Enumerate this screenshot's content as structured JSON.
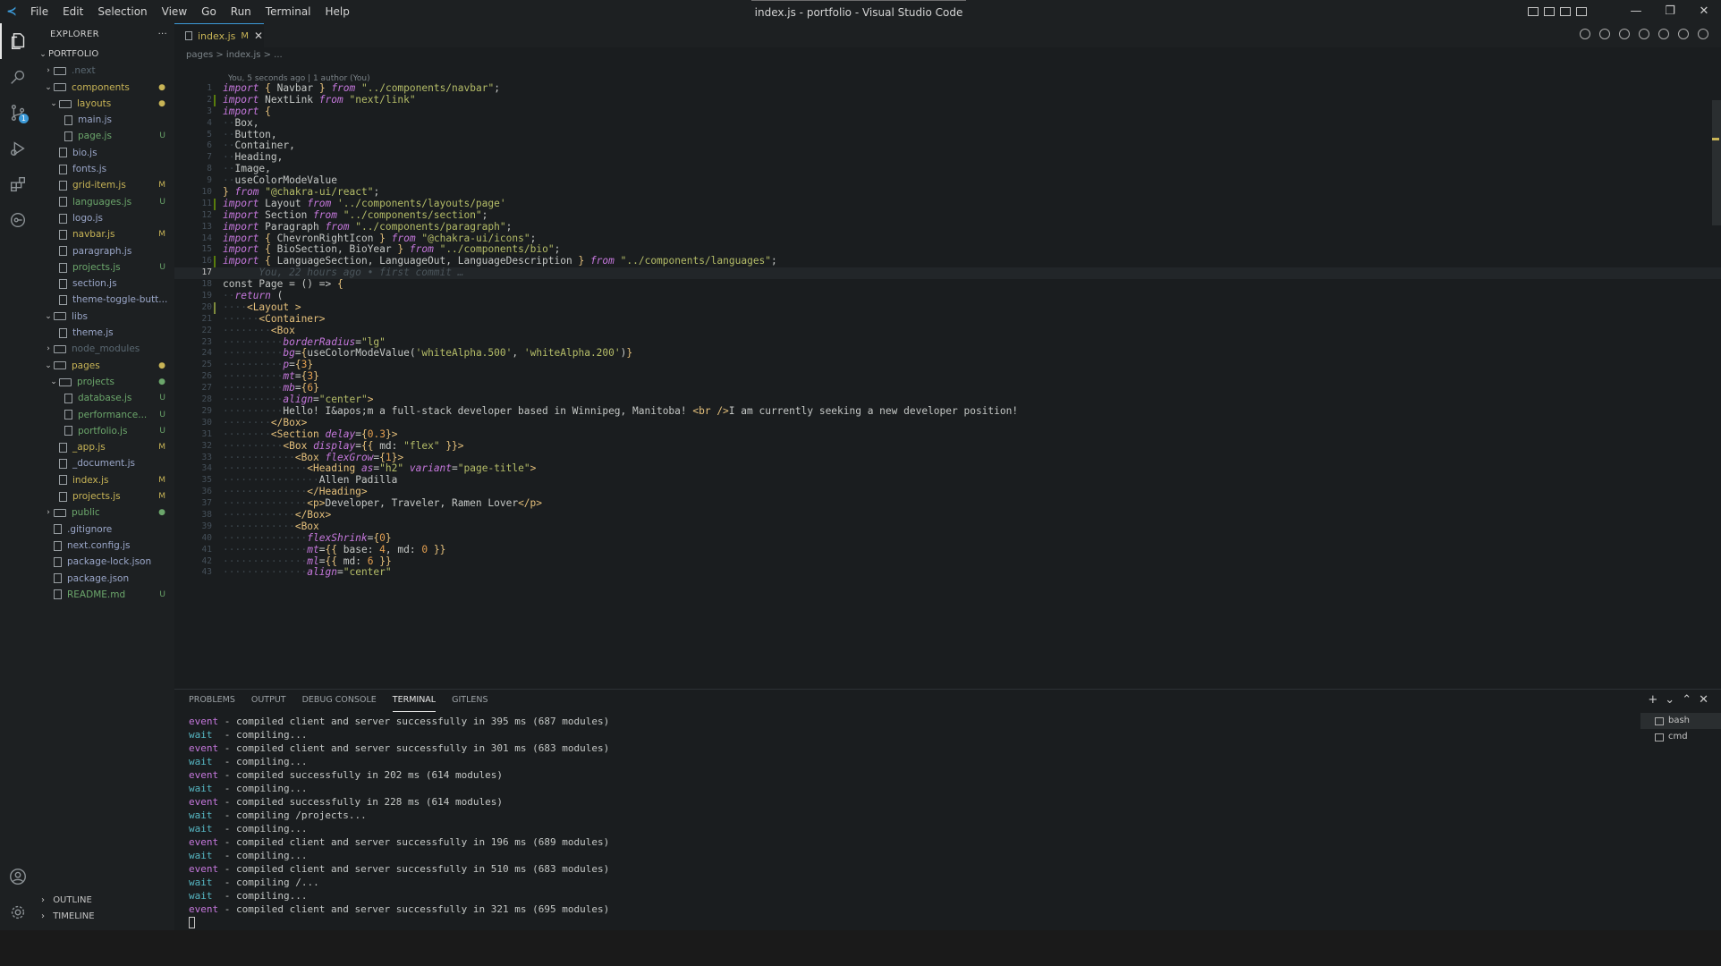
{
  "window": {
    "title": "index.js - portfolio - Visual Studio Code",
    "menu": [
      "File",
      "Edit",
      "Selection",
      "View",
      "Go",
      "Run",
      "Terminal",
      "Help"
    ],
    "controls": [
      "—",
      "❐",
      "✕"
    ]
  },
  "activity_bar": {
    "items": [
      "explorer-icon",
      "search-icon",
      "source-control-icon",
      "run-debug-icon",
      "extensions-icon",
      "gitlens-icon"
    ],
    "scm_badge": "1",
    "bottom": [
      "account-icon",
      "settings-icon"
    ]
  },
  "sidebar": {
    "title": "EXPLORER",
    "more": "···",
    "root": "PORTFOLIO",
    "tree": [
      {
        "indent": 1,
        "kind": "folder",
        "open": false,
        "name": ".next",
        "style": "dim",
        "badge": ""
      },
      {
        "indent": 1,
        "kind": "folder",
        "open": true,
        "name": "components",
        "style": "mod",
        "badge": "●"
      },
      {
        "indent": 2,
        "kind": "folder",
        "open": true,
        "name": "layouts",
        "style": "mod",
        "badge": "●"
      },
      {
        "indent": 3,
        "kind": "file",
        "name": "main.js",
        "style": "normal",
        "badge": ""
      },
      {
        "indent": 3,
        "kind": "file",
        "name": "page.js",
        "style": "untracked",
        "badge": "U"
      },
      {
        "indent": 2,
        "kind": "file",
        "name": "bio.js",
        "style": "normal",
        "badge": ""
      },
      {
        "indent": 2,
        "kind": "file",
        "name": "fonts.js",
        "style": "normal",
        "badge": ""
      },
      {
        "indent": 2,
        "kind": "file",
        "name": "grid-item.js",
        "style": "mod",
        "badge": "M"
      },
      {
        "indent": 2,
        "kind": "file",
        "name": "languages.js",
        "style": "untracked",
        "badge": "U"
      },
      {
        "indent": 2,
        "kind": "file",
        "name": "logo.js",
        "style": "normal",
        "badge": ""
      },
      {
        "indent": 2,
        "kind": "file",
        "name": "navbar.js",
        "style": "mod",
        "badge": "M"
      },
      {
        "indent": 2,
        "kind": "file",
        "name": "paragraph.js",
        "style": "normal",
        "badge": ""
      },
      {
        "indent": 2,
        "kind": "file",
        "name": "projects.js",
        "style": "untracked",
        "badge": "U"
      },
      {
        "indent": 2,
        "kind": "file",
        "name": "section.js",
        "style": "normal",
        "badge": ""
      },
      {
        "indent": 2,
        "kind": "file",
        "name": "theme-toggle-butt...",
        "style": "normal",
        "badge": ""
      },
      {
        "indent": 1,
        "kind": "folder",
        "open": true,
        "name": "libs",
        "style": "normal",
        "badge": ""
      },
      {
        "indent": 2,
        "kind": "file",
        "name": "theme.js",
        "style": "normal",
        "badge": ""
      },
      {
        "indent": 1,
        "kind": "folder",
        "open": false,
        "name": "node_modules",
        "style": "dim",
        "badge": ""
      },
      {
        "indent": 1,
        "kind": "folder",
        "open": true,
        "name": "pages",
        "style": "mod",
        "badge": "●"
      },
      {
        "indent": 2,
        "kind": "folder",
        "open": true,
        "name": "projects",
        "style": "untracked",
        "badge": "●"
      },
      {
        "indent": 3,
        "kind": "file",
        "name": "database.js",
        "style": "untracked",
        "badge": "U"
      },
      {
        "indent": 3,
        "kind": "file",
        "name": "performance...",
        "style": "untracked",
        "badge": "U"
      },
      {
        "indent": 3,
        "kind": "file",
        "name": "portfolio.js",
        "style": "untracked",
        "badge": "U"
      },
      {
        "indent": 2,
        "kind": "file",
        "name": "_app.js",
        "style": "mod",
        "badge": "M"
      },
      {
        "indent": 2,
        "kind": "file",
        "name": "_document.js",
        "style": "normal",
        "badge": ""
      },
      {
        "indent": 2,
        "kind": "file",
        "name": "index.js",
        "style": "mod",
        "badge": "M"
      },
      {
        "indent": 2,
        "kind": "file",
        "name": "projects.js",
        "style": "mod",
        "badge": "M"
      },
      {
        "indent": 1,
        "kind": "folder",
        "open": false,
        "name": "public",
        "style": "untracked",
        "badge": "●"
      },
      {
        "indent": 1,
        "kind": "file",
        "name": ".gitignore",
        "style": "normal",
        "badge": ""
      },
      {
        "indent": 1,
        "kind": "file",
        "name": "next.config.js",
        "style": "normal",
        "badge": ""
      },
      {
        "indent": 1,
        "kind": "file",
        "name": "package-lock.json",
        "style": "normal",
        "badge": ""
      },
      {
        "indent": 1,
        "kind": "file",
        "name": "package.json",
        "style": "normal",
        "badge": ""
      },
      {
        "indent": 1,
        "kind": "file",
        "name": "README.md",
        "style": "untracked",
        "badge": "U"
      }
    ],
    "outline": "OUTLINE",
    "timeline": "TIMELINE"
  },
  "editor": {
    "tab": {
      "name": "index.js",
      "status": "M",
      "close": "✕"
    },
    "breadcrumb": "pages  >  index.js  > ...",
    "blame_header": "You, 5 seconds ago | 1 author (You)",
    "current_line": 17,
    "lines": [
      {
        "n": 1,
        "g": "",
        "h": "<span class='kw'>import</span> <span class='punct'>{</span> Navbar <span class='punct'>}</span> <span class='kw'>from</span> <span class='str'>\"../components/navbar\"</span>;"
      },
      {
        "n": 2,
        "g": "add",
        "h": "<span class='kw'>import</span> NextLink <span class='kw'>from</span> <span class='str'>\"next/link\"</span>"
      },
      {
        "n": 3,
        "g": "",
        "h": "<span class='kw'>import</span> <span class='punct'>{</span>"
      },
      {
        "n": 4,
        "g": "",
        "h": "<span class='ghost'>··</span>Box,"
      },
      {
        "n": 5,
        "g": "",
        "h": "<span class='ghost'>··</span>Button,"
      },
      {
        "n": 6,
        "g": "",
        "h": "<span class='ghost'>··</span>Container,"
      },
      {
        "n": 7,
        "g": "",
        "h": "<span class='ghost'>··</span>Heading,"
      },
      {
        "n": 8,
        "g": "",
        "h": "<span class='ghost'>··</span>Image,"
      },
      {
        "n": 9,
        "g": "",
        "h": "<span class='ghost'>··</span>useColorModeValue"
      },
      {
        "n": 10,
        "g": "",
        "h": "<span class='punct'>}</span> <span class='kw'>from</span> <span class='str'>\"@chakra-ui/react\"</span>;"
      },
      {
        "n": 11,
        "g": "add",
        "h": "<span class='kw'>import</span> Layout <span class='kw'>from</span> <span class='str'>'../components/layouts/page'</span>"
      },
      {
        "n": 12,
        "g": "",
        "h": "<span class='kw'>import</span> Section <span class='kw'>from</span> <span class='str'>\"../components/section\"</span>;"
      },
      {
        "n": 13,
        "g": "",
        "h": "<span class='kw'>import</span> Paragraph <span class='kw'>from</span> <span class='str'>\"../components/paragraph\"</span>;"
      },
      {
        "n": 14,
        "g": "",
        "h": "<span class='kw'>import</span> <span class='punct'>{</span> ChevronRightIcon <span class='punct'>}</span> <span class='kw'>from</span> <span class='str'>\"@chakra-ui/icons\"</span>;"
      },
      {
        "n": 15,
        "g": "",
        "h": "<span class='kw'>import</span> <span class='punct'>{</span> BioSection, BioYear <span class='punct'>}</span> <span class='kw'>from</span> <span class='str'>\"../components/bio\"</span>;"
      },
      {
        "n": 16,
        "g": "add",
        "h": "<span class='kw'>import</span> <span class='punct'>{</span> LanguageSection, LanguageOut, LanguageDescription <span class='punct'>}</span> <span class='kw'>from</span> <span class='str'>\"../components/languages\"</span>;"
      },
      {
        "n": 17,
        "g": "",
        "h": "<span class='blame'>      You, 22 hours ago • first commit …</span>"
      },
      {
        "n": 18,
        "g": "",
        "h": "const Page = () => <span class='punct'>{</span>"
      },
      {
        "n": 19,
        "g": "",
        "h": "<span class='ghost'>··</span><span class='kw'>return</span> ("
      },
      {
        "n": 20,
        "g": "chg",
        "h": "<span class='ghost'>····</span><span class='tag'>&lt;Layout</span> <span class='tag'>&gt;</span>"
      },
      {
        "n": 21,
        "g": "",
        "h": "<span class='ghost'>······</span><span class='tag'>&lt;Container&gt;</span>"
      },
      {
        "n": 22,
        "g": "",
        "h": "<span class='ghost'>········</span><span class='tag'>&lt;Box</span>"
      },
      {
        "n": 23,
        "g": "",
        "h": "<span class='ghost'>··········</span><span class='attr'>borderRadius</span>=<span class='str'>\"lg\"</span>"
      },
      {
        "n": 24,
        "g": "",
        "h": "<span class='ghost'>··········</span><span class='attr'>bg</span>=<span class='punct'>{</span>useColorModeValue(<span class='str'>'whiteAlpha.500'</span>, <span class='str'>'whiteAlpha.200'</span>)<span class='punct'>}</span>"
      },
      {
        "n": 25,
        "g": "",
        "h": "<span class='ghost'>··········</span><span class='attr'>p</span>=<span class='punct'>{</span><span class='num'>3</span><span class='punct'>}</span>"
      },
      {
        "n": 26,
        "g": "",
        "h": "<span class='ghost'>··········</span><span class='attr'>mt</span>=<span class='punct'>{</span><span class='num'>3</span><span class='punct'>}</span>"
      },
      {
        "n": 27,
        "g": "",
        "h": "<span class='ghost'>··········</span><span class='attr'>mb</span>=<span class='punct'>{</span><span class='num'>6</span><span class='punct'>}</span>"
      },
      {
        "n": 28,
        "g": "",
        "h": "<span class='ghost'>··········</span><span class='attr'>align</span>=<span class='str'>\"center\"</span><span class='tag'>&gt;</span>"
      },
      {
        "n": 29,
        "g": "",
        "h": "<span class='ghost'>··········</span>Hello! I&amp;apos;m a full-stack developer based in Winnipeg, Manitoba! <span class='tag'>&lt;br /&gt;</span>I am currently seeking a new developer position!"
      },
      {
        "n": 30,
        "g": "",
        "h": "<span class='ghost'>········</span><span class='tag'>&lt;/Box&gt;</span>"
      },
      {
        "n": 31,
        "g": "",
        "h": "<span class='ghost'>········</span><span class='tag'>&lt;Section</span> <span class='attr'>delay</span>=<span class='punct'>{</span><span class='num'>0.3</span><span class='punct'>}</span><span class='tag'>&gt;</span>"
      },
      {
        "n": 32,
        "g": "",
        "h": "<span class='ghost'>··········</span><span class='tag'>&lt;Box</span> <span class='attr'>display</span>=<span class='punct'>{{</span> md: <span class='str'>\"flex\"</span> <span class='punct'>}}</span><span class='tag'>&gt;</span>"
      },
      {
        "n": 33,
        "g": "",
        "h": "<span class='ghost'>············</span><span class='tag'>&lt;Box</span> <span class='attr'>flexGrow</span>=<span class='punct'>{</span><span class='num'>1</span><span class='punct'>}</span><span class='tag'>&gt;</span>"
      },
      {
        "n": 34,
        "g": "",
        "h": "<span class='ghost'>··············</span><span class='tag'>&lt;Heading</span> <span class='attr'>as</span>=<span class='str'>\"h2\"</span> <span class='attr'>variant</span>=<span class='str'>\"page-title\"</span><span class='tag'>&gt;</span>"
      },
      {
        "n": 35,
        "g": "",
        "h": "<span class='ghost'>················</span>Allen Padilla"
      },
      {
        "n": 36,
        "g": "",
        "h": "<span class='ghost'>··············</span><span class='tag'>&lt;/Heading&gt;</span>"
      },
      {
        "n": 37,
        "g": "",
        "h": "<span class='ghost'>··············</span><span class='tag'>&lt;p&gt;</span>Developer, Traveler, Ramen Lover<span class='tag'>&lt;/p&gt;</span>"
      },
      {
        "n": 38,
        "g": "",
        "h": "<span class='ghost'>············</span><span class='tag'>&lt;/Box&gt;</span>"
      },
      {
        "n": 39,
        "g": "",
        "h": "<span class='ghost'>············</span><span class='tag'>&lt;Box</span>"
      },
      {
        "n": 40,
        "g": "",
        "h": "<span class='ghost'>··············</span><span class='attr'>flexShrink</span>=<span class='punct'>{</span><span class='num'>0</span><span class='punct'>}</span>"
      },
      {
        "n": 41,
        "g": "",
        "h": "<span class='ghost'>··············</span><span class='attr'>mt</span>=<span class='punct'>{{</span> base: <span class='num'>4</span>, md: <span class='num'>0</span> <span class='punct'>}}</span>"
      },
      {
        "n": 42,
        "g": "",
        "h": "<span class='ghost'>··············</span><span class='attr'>ml</span>=<span class='punct'>{{</span> md: <span class='num'>6</span> <span class='punct'>}}</span>"
      },
      {
        "n": 43,
        "g": "",
        "h": "<span class='ghost'>··············</span><span class='attr'>align</span>=<span class='str'>\"center\"</span>"
      }
    ]
  },
  "panel": {
    "tabs": [
      "PROBLEMS",
      "OUTPUT",
      "DEBUG CONSOLE",
      "TERMINAL",
      "GITLENS"
    ],
    "active_tab": "TERMINAL",
    "actions": [
      "+",
      "⌄",
      "⌃",
      "✕"
    ],
    "terminal_lines": [
      {
        "kind": "event",
        "text": " - compiled client and server successfully in 395 ms (687 modules)"
      },
      {
        "kind": "wait",
        "text": "  - compiling..."
      },
      {
        "kind": "event",
        "text": " - compiled client and server successfully in 301 ms (683 modules)"
      },
      {
        "kind": "wait",
        "text": "  - compiling..."
      },
      {
        "kind": "event",
        "text": " - compiled successfully in 202 ms (614 modules)"
      },
      {
        "kind": "wait",
        "text": "  - compiling..."
      },
      {
        "kind": "event",
        "text": " - compiled successfully in 228 ms (614 modules)"
      },
      {
        "kind": "wait",
        "text": "  - compiling /projects..."
      },
      {
        "kind": "wait",
        "text": "  - compiling..."
      },
      {
        "kind": "event",
        "text": " - compiled client and server successfully in 196 ms (689 modules)"
      },
      {
        "kind": "wait",
        "text": "  - compiling..."
      },
      {
        "kind": "event",
        "text": " - compiled client and server successfully in 510 ms (683 modules)"
      },
      {
        "kind": "wait",
        "text": "  - compiling /..."
      },
      {
        "kind": "wait",
        "text": "  - compiling..."
      },
      {
        "kind": "event",
        "text": " - compiled client and server successfully in 321 ms (695 modules)"
      }
    ],
    "terminals": [
      "bash",
      "cmd"
    ]
  }
}
